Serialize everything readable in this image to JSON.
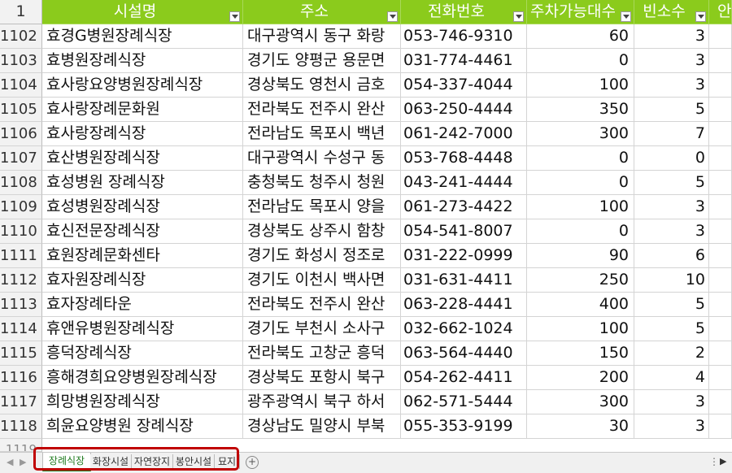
{
  "header": {
    "row_number": "1",
    "columns": [
      "시설명",
      "주소",
      "전화번호",
      "주차가능대수",
      "빈소수",
      "안"
    ]
  },
  "rows": [
    {
      "num": "1102",
      "name": "효경G병원장례식장",
      "addr": "대구광역시 동구 화랑",
      "phone": "053-746-9310",
      "park": "60",
      "empty": "3"
    },
    {
      "num": "1103",
      "name": "효병원장례식장",
      "addr": "경기도 양평군 용문면",
      "phone": "031-774-4461",
      "park": "0",
      "empty": "3"
    },
    {
      "num": "1104",
      "name": "효사랑요양병원장례식장",
      "addr": "경상북도 영천시 금호",
      "phone": "054-337-4044",
      "park": "100",
      "empty": "3"
    },
    {
      "num": "1105",
      "name": "효사랑장례문화원",
      "addr": "전라북도 전주시 완산",
      "phone": "063-250-4444",
      "park": "350",
      "empty": "5"
    },
    {
      "num": "1106",
      "name": "효사랑장례식장",
      "addr": "전라남도 목포시 백년",
      "phone": "061-242-7000",
      "park": "300",
      "empty": "7"
    },
    {
      "num": "1107",
      "name": "효산병원장례식장",
      "addr": "대구광역시 수성구 동",
      "phone": "053-768-4448",
      "park": "0",
      "empty": "0"
    },
    {
      "num": "1108",
      "name": "효성병원 장례식장",
      "addr": "충청북도 청주시 청원",
      "phone": "043-241-4444",
      "park": "0",
      "empty": "5"
    },
    {
      "num": "1109",
      "name": "효성병원장례식장",
      "addr": "전라남도 목포시 양을",
      "phone": "061-273-4422",
      "park": "100",
      "empty": "3"
    },
    {
      "num": "1110",
      "name": "효신전문장례식장",
      "addr": "경상북도 상주시 함창",
      "phone": "054-541-8007",
      "park": "0",
      "empty": "3"
    },
    {
      "num": "1111",
      "name": "효원장례문화센타",
      "addr": "경기도 화성시 정조로",
      "phone": "031-222-0999",
      "park": "90",
      "empty": "6"
    },
    {
      "num": "1112",
      "name": "효자원장례식장",
      "addr": "경기도 이천시 백사면",
      "phone": "031-631-4411",
      "park": "250",
      "empty": "10"
    },
    {
      "num": "1113",
      "name": "효자장례타운",
      "addr": "전라북도 전주시 완산",
      "phone": "063-228-4441",
      "park": "400",
      "empty": "5"
    },
    {
      "num": "1114",
      "name": "휴앤유병원장례식장",
      "addr": "경기도 부천시 소사구",
      "phone": "032-662-1024",
      "park": "100",
      "empty": "5"
    },
    {
      "num": "1115",
      "name": "흥덕장례식장",
      "addr": "전라북도 고창군 흥덕",
      "phone": "063-564-4440",
      "park": "150",
      "empty": "2"
    },
    {
      "num": "1116",
      "name": "흥해경희요양병원장례식장",
      "addr": "경상북도 포항시 북구",
      "phone": "054-262-4411",
      "park": "200",
      "empty": "4"
    },
    {
      "num": "1117",
      "name": "희망병원장례식장",
      "addr": "광주광역시 북구 하서",
      "phone": "062-571-5444",
      "park": "300",
      "empty": "3"
    },
    {
      "num": "1118",
      "name": "희윤요양병원 장례식장",
      "addr": "경상남도 밀양시 부북",
      "phone": "055-353-9199",
      "park": "30",
      "empty": "3"
    }
  ],
  "partial_row_number": "1119",
  "sheet_tabs": {
    "tabs": [
      "장례식장",
      "화장시설",
      "자연장지",
      "봉안시설",
      "묘지"
    ],
    "active_index": 0,
    "add_icon": "plus-circle-icon",
    "add_symbol": "+",
    "options_symbol": "⋮",
    "scroll_right_symbol": "▶",
    "nav_prev_symbol": "◀",
    "nav_next_symbol": "▶"
  },
  "colors": {
    "header_bg": "#8bcb1c",
    "highlight_border": "#c00000",
    "active_tab_text": "#1f7a1f"
  }
}
